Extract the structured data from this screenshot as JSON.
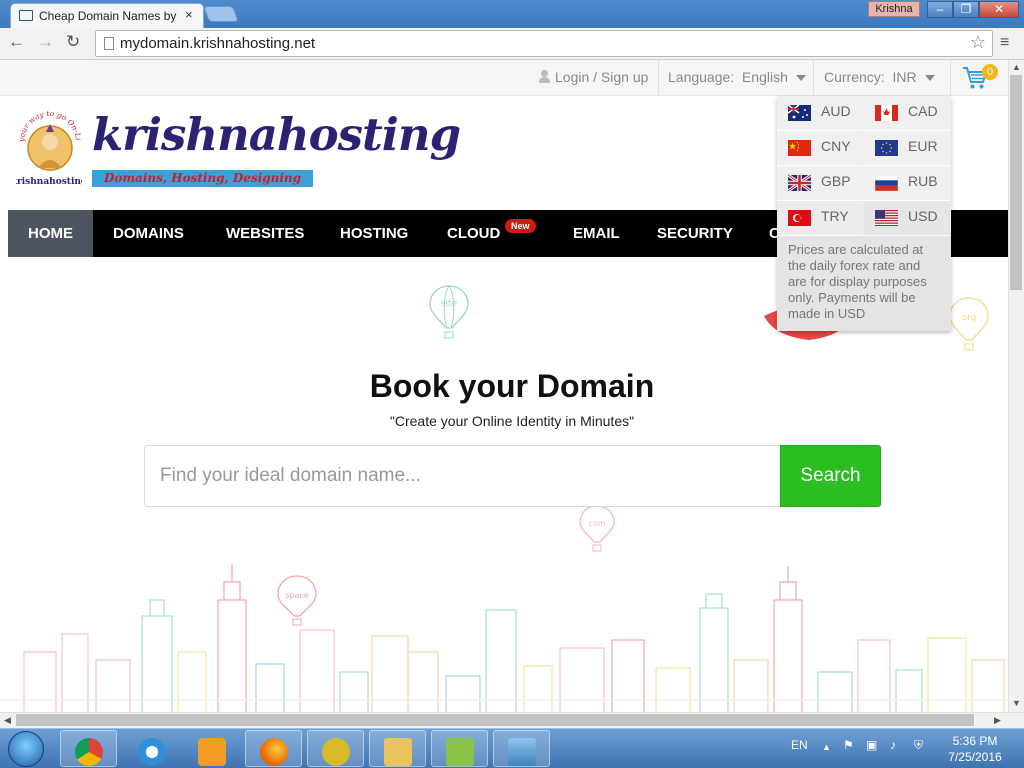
{
  "browser": {
    "tab_title": "Cheap Domain Names by",
    "tab_close": "×",
    "user": "Krishna",
    "url": "mydomain.krishnahosting.net",
    "window_minimize": "–",
    "window_restore": "❐",
    "window_close": "✕"
  },
  "topbar": {
    "login": "Login / Sign up",
    "language_label": "Language:",
    "language_value": "English",
    "currency_label": "Currency:",
    "currency_value": "INR",
    "cart_count": "0"
  },
  "brand": {
    "name": "krishnahosting",
    "tagline": "Domains, Hosting, Designing",
    "seal_text_top": "your way to go On-Line",
    "seal_text_bottom": "krishnahosting"
  },
  "nav": {
    "items": [
      "HOME",
      "DOMAINS",
      "WEBSITES",
      "HOSTING",
      "CLOUD",
      "EMAIL",
      "SECURITY",
      "C"
    ],
    "new_badge": "New"
  },
  "currency_menu": {
    "options": [
      {
        "code": "AUD",
        "flag": "australia-flag"
      },
      {
        "code": "CAD",
        "flag": "canada-flag"
      },
      {
        "code": "CNY",
        "flag": "china-flag"
      },
      {
        "code": "EUR",
        "flag": "eu-flag"
      },
      {
        "code": "GBP",
        "flag": "uk-flag"
      },
      {
        "code": "RUB",
        "flag": "russia-flag"
      },
      {
        "code": "TRY",
        "flag": "turkey-flag"
      },
      {
        "code": "USD",
        "flag": "usa-flag"
      }
    ],
    "note": "Prices are calculated at the daily forex rate and are for display purposes only. Payments will be made in USD"
  },
  "hero": {
    "title": "Book your Domain",
    "subtitle": "\"Create your Online Identity in Minutes\"",
    "search_placeholder": "Find your ideal domain name...",
    "search_button": "Search"
  },
  "balloons": [
    "site",
    "org",
    "com",
    "space"
  ],
  "taskbar": {
    "lang": "EN",
    "time": "5:36 PM",
    "date": "7/25/2016"
  },
  "colors": {
    "brand_navy": "#2b2272",
    "nav_bg": "#000000",
    "nav_active": "#4d5561",
    "search_green": "#2cbd22",
    "new_badge_red": "#d01a12",
    "cart_badge": "#f2b51c"
  }
}
